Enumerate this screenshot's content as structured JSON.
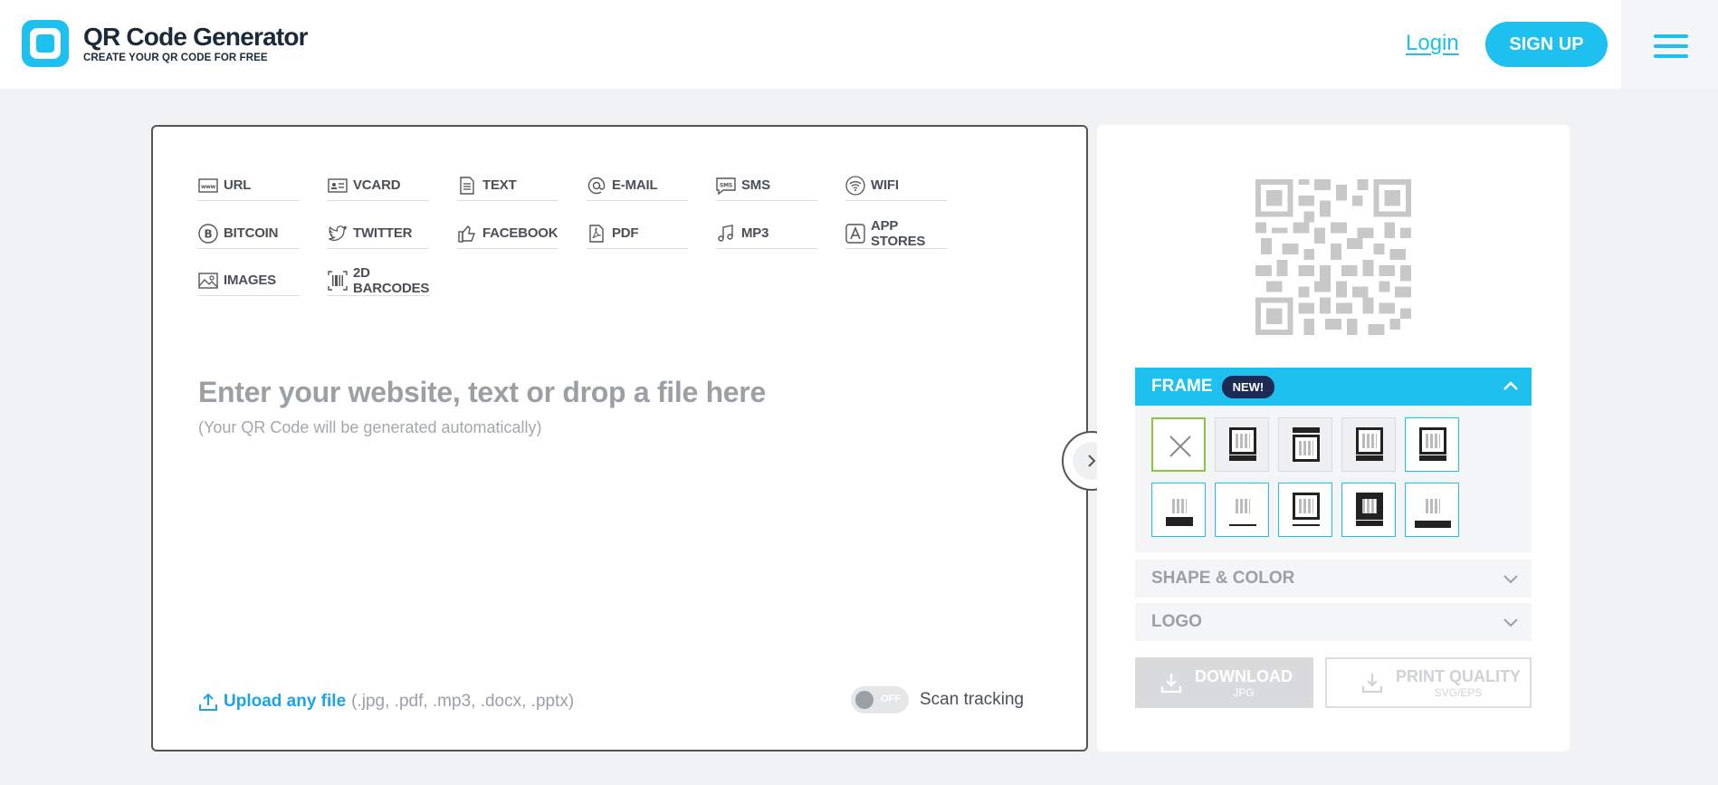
{
  "header": {
    "title": "QR Code Generator",
    "subtitle": "CREATE YOUR QR CODE FOR FREE",
    "login": "Login",
    "signup": "SIGN UP"
  },
  "types": [
    {
      "label": "URL",
      "icon": "www-icon"
    },
    {
      "label": "VCARD",
      "icon": "vcard-icon"
    },
    {
      "label": "TEXT",
      "icon": "text-icon"
    },
    {
      "label": "E-MAIL",
      "icon": "at-icon"
    },
    {
      "label": "SMS",
      "icon": "sms-icon"
    },
    {
      "label": "WIFI",
      "icon": "wifi-icon"
    },
    {
      "label": "BITCOIN",
      "icon": "bitcoin-icon"
    },
    {
      "label": "TWITTER",
      "icon": "twitter-icon"
    },
    {
      "label": "FACEBOOK",
      "icon": "thumbs-up-icon"
    },
    {
      "label": "PDF",
      "icon": "pdf-icon"
    },
    {
      "label": "MP3",
      "icon": "music-note-icon"
    },
    {
      "label": "APP STORES",
      "icon": "app-store-icon"
    },
    {
      "label": "IMAGES",
      "icon": "image-icon"
    },
    {
      "label": "2D BARCODES",
      "icon": "barcode-icon"
    }
  ],
  "input": {
    "placeholder_title": "Enter your website, text or drop a file here",
    "placeholder_sub": "(Your QR Code will be generated automatically)"
  },
  "upload": {
    "link": "Upload any file",
    "extensions": "(.jpg, .pdf, .mp3, .docx, .pptx)"
  },
  "scan_tracking": {
    "toggle_state": "OFF",
    "label": "Scan tracking"
  },
  "customize": {
    "frame_label": "FRAME",
    "frame_badge": "NEW!",
    "shape_color_label": "SHAPE & COLOR",
    "logo_label": "LOGO"
  },
  "download": {
    "main": "DOWNLOAD",
    "sub": "JPG"
  },
  "print_quality": {
    "main": "PRINT QUALITY",
    "sub": "SVG/EPS"
  },
  "colors": {
    "accent": "#1ec0f0",
    "badge": "#1c2b54",
    "selected_frame": "#8cc63f"
  }
}
